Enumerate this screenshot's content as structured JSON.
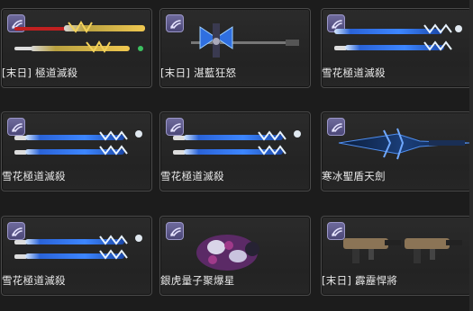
{
  "items": [
    {
      "label": "[末日] 極道滅殺",
      "icon": "dual-gold-blade-icon"
    },
    {
      "label": "[末日] 湛藍狂怒",
      "icon": "double-axe-staff-icon"
    },
    {
      "label": "雪花極道滅殺",
      "icon": "dual-blue-blade-icon"
    },
    {
      "label": "雪花極道滅殺",
      "icon": "dual-blue-blade-icon"
    },
    {
      "label": "雪花極道滅殺",
      "icon": "dual-blue-blade-icon"
    },
    {
      "label": "寒冰聖盾天劍",
      "icon": "ice-greatsword-icon"
    },
    {
      "label": "雪花極道滅殺",
      "icon": "dual-blue-blade-icon"
    },
    {
      "label": "銀虎量子聚爆星",
      "icon": "quantum-grenade-icon"
    },
    {
      "label": "[末日] 霹靂悍將",
      "icon": "dual-smg-icon"
    }
  ],
  "colors": {
    "badge": "#5a5688",
    "card_border": "#4a4a4a",
    "label_text": "#e8e8e8"
  }
}
